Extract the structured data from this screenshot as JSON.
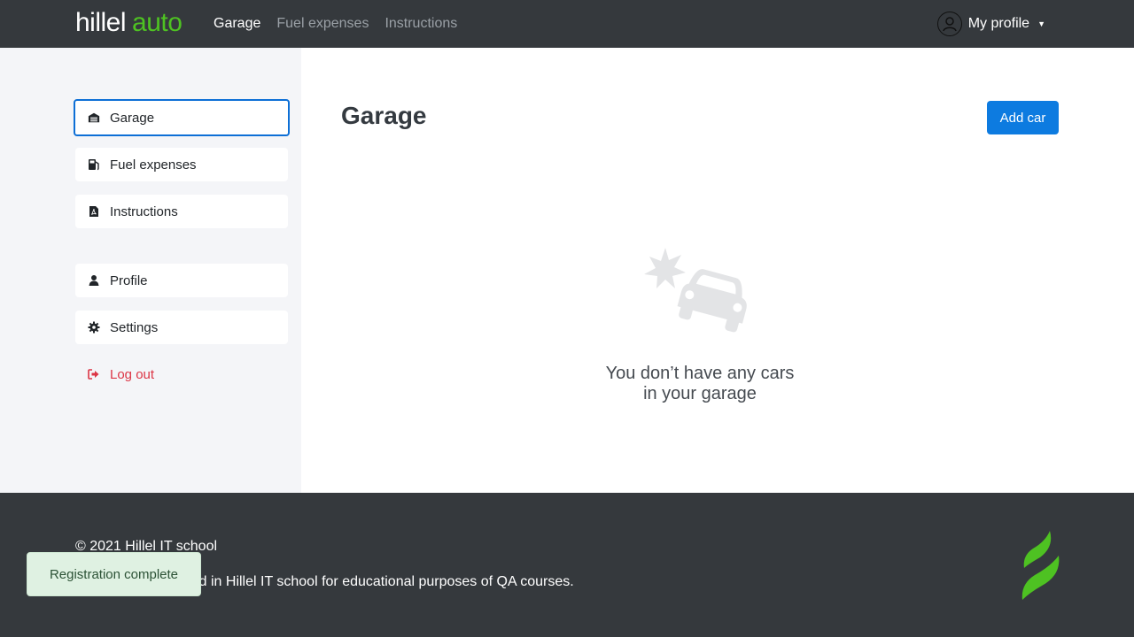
{
  "header": {
    "logo_part1": "hillel",
    "logo_part2": "auto",
    "nav": [
      "Garage",
      "Fuel expenses",
      "Instructions"
    ],
    "profile_label": "My profile"
  },
  "sidebar": {
    "items": [
      {
        "label": "Garage",
        "icon": "garage-icon"
      },
      {
        "label": "Fuel expenses",
        "icon": "fuel-icon"
      },
      {
        "label": "Instructions",
        "icon": "pdf-icon"
      },
      {
        "label": "Profile",
        "icon": "user-icon"
      },
      {
        "label": "Settings",
        "icon": "gear-icon"
      }
    ],
    "logout_label": "Log out"
  },
  "main": {
    "title": "Garage",
    "add_car_label": "Add car",
    "empty_line1": "You don’t have any cars",
    "empty_line2": "in your garage"
  },
  "footer": {
    "copyright": "© 2021 Hillel IT school",
    "disclaimer": "Hillel auto developed in Hillel IT school for educational purposes of QA courses."
  },
  "toast": {
    "message": "Registration complete"
  },
  "colors": {
    "header_bg": "#35393d",
    "brand_green": "#4ec222",
    "accent_blue": "#0d7be0",
    "danger": "#dc3545",
    "toast_bg": "#dff1e2"
  }
}
